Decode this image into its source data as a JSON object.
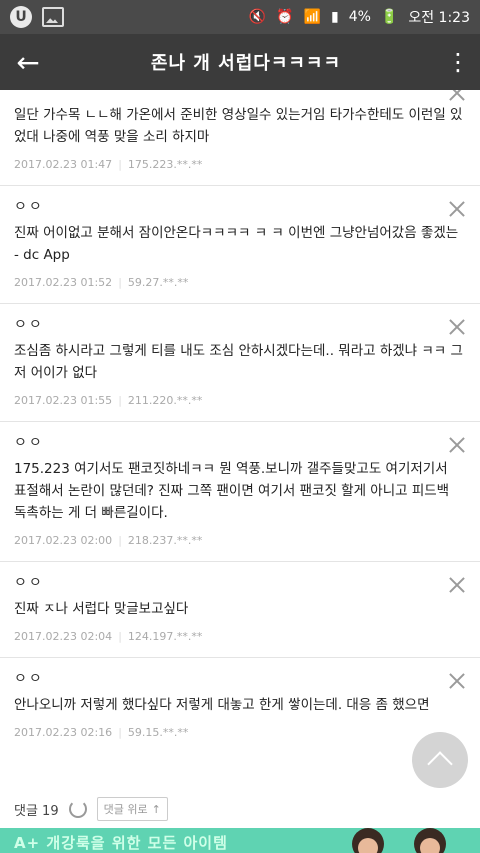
{
  "status_bar": {
    "battery": "4%",
    "time": "오전 1:23"
  },
  "header": {
    "title": "존나 개 서럽다ㅋㅋㅋㅋ"
  },
  "comments": [
    {
      "nick": "",
      "body": "일단 가수목 ㄴㄴ해 가온에서 준비한 영상일수 있는거임 타가수한테도 이런일 있었대 나중에 역풍 맞을 소리 하지마",
      "date": "2017.02.23 01:47",
      "ip": "175.223.**.**"
    },
    {
      "nick": "ㅇㅇ",
      "body": "진짜 어이없고 분해서 잠이안온다ㅋㅋㅋㅋ ㅋ ㅋ 이번엔 그냥안넘어갔음 좋겠는 - dc App",
      "date": "2017.02.23 01:52",
      "ip": "59.27.**.**"
    },
    {
      "nick": "ㅇㅇ",
      "body": "조심좀 하시라고 그렇게 티를 내도 조심 안하시겠다는데.. 뭐라고 하겠냐 ㅋㅋ 그저 어이가 없다",
      "date": "2017.02.23 01:55",
      "ip": "211.220.**.**"
    },
    {
      "nick": "ㅇㅇ",
      "body": "175.223 여기서도 팬코짓하네ㅋㅋ 뭔 역풍.보니까 갤주들맞고도 여기저기서 표절해서 논란이 많던데? 진짜 그쪽 팬이면 여기서 팬코짓 할게 아니고 피드백 독촉하는 게 더 빠른길이다.",
      "date": "2017.02.23 02:00",
      "ip": "218.237.**.**"
    },
    {
      "nick": "ㅇㅇ",
      "body": "진짜 ㅈ나 서럽다 맞글보고싶다",
      "date": "2017.02.23 02:04",
      "ip": "124.197.**.**"
    },
    {
      "nick": "ㅇㅇ",
      "body": "안나오니까 저렇게 했다싶다 저렇게 대놓고 한게 쌓이는데. 대응 좀 했으면",
      "date": "2017.02.23 02:16",
      "ip": "59.15.**.**"
    }
  ],
  "footer": {
    "comment_count": "댓글 19",
    "up_label": "댓글 위로"
  },
  "ad": {
    "text": "A+ 개강룩을 위한 모든 아이템"
  }
}
